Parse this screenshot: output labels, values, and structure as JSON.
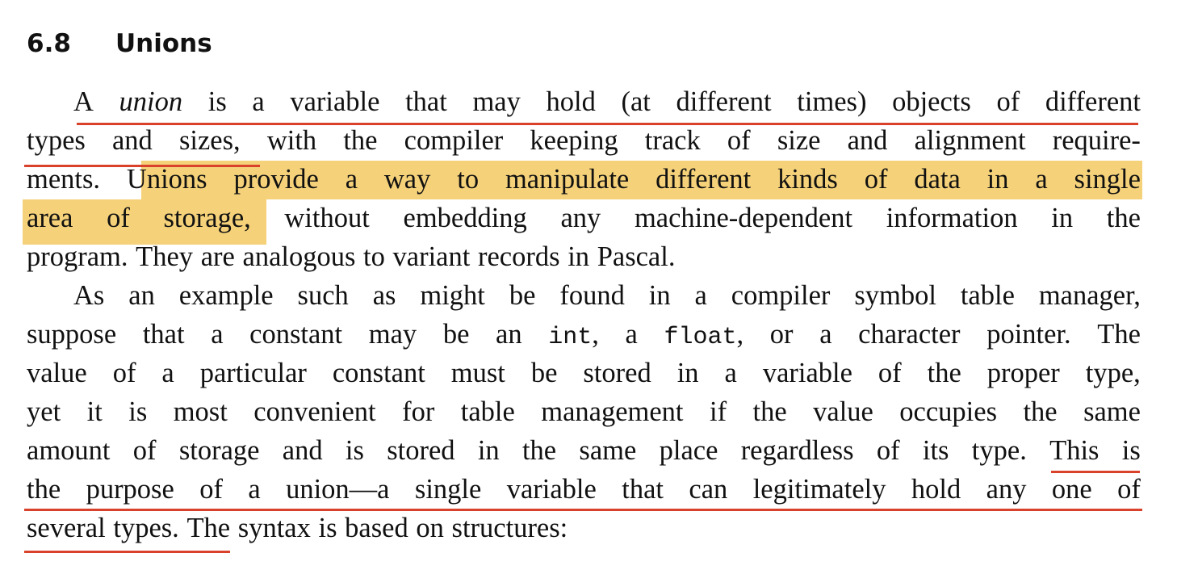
{
  "section": {
    "number": "6.8",
    "title": "Unions"
  },
  "lines": [
    "A |union| is a variable that may hold (at different times) objects of different",
    "types and sizes, with the compiler keeping track of size and alignment require-",
    "ments.  Unions provide a way to manipulate different kinds of data in a single",
    "area of storage, without embedding any machine-dependent information in the",
    "program.  They are analogous to variant records in Pascal.",
    "As an example such as might be found in a compiler symbol table manager,",
    "suppose that a constant may be an |int|, a |float|, or a character pointer.  The",
    "value of a particular constant must be stored in a variable of the proper type,",
    "yet it is most convenient for table management if the value occupies the same",
    "amount of storage and is stored in the same place regardless of its type.  This is",
    "the purpose of a union—a single variable that can legitimately hold any one of",
    "several types.  The syntax is based on structures:"
  ],
  "annotations": {
    "highlight_color": "#f5d27a",
    "underline_color": "#d9412b"
  }
}
